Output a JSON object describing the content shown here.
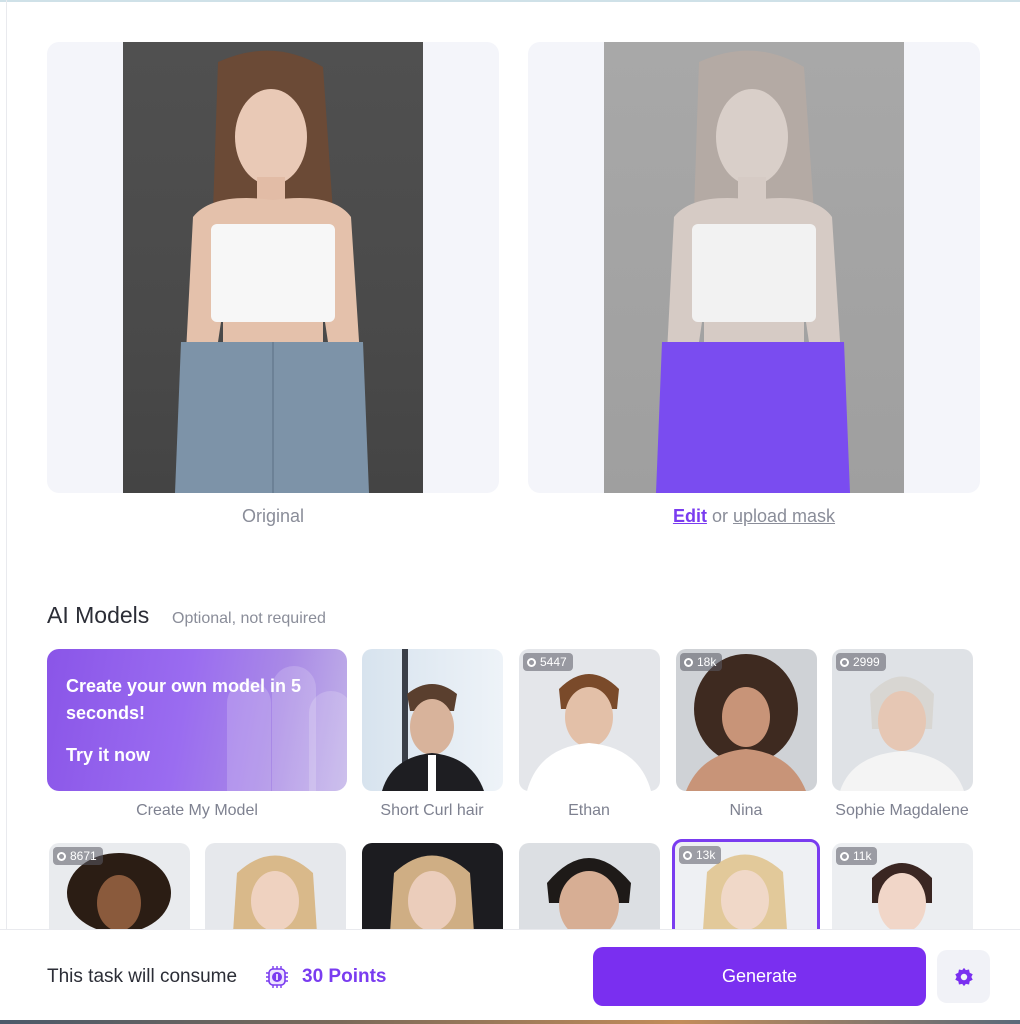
{
  "preview": {
    "original_caption": "Original",
    "edit_link": "Edit",
    "or_text": "or",
    "upload_mask_link": "upload mask",
    "mask_color": "#7a4cf0"
  },
  "models_section": {
    "title": "AI Models",
    "subtitle": "Optional, not required",
    "create_card": {
      "title": "Create your own model in 5 seconds!",
      "cta": "Try it now",
      "name": "Create My Model"
    },
    "row1": [
      {
        "name": "Short Curl hair",
        "count": ""
      },
      {
        "name": "Ethan",
        "count": "5447"
      },
      {
        "name": "Nina",
        "count": "18k"
      },
      {
        "name": "Sophie Magdalene",
        "count": "2999"
      }
    ],
    "row2": [
      {
        "count": "8671"
      },
      {
        "count": ""
      },
      {
        "count": ""
      },
      {
        "count": ""
      },
      {
        "count": "13k",
        "selected": true
      },
      {
        "count": "11k"
      }
    ]
  },
  "footer": {
    "consume_text": "This task will consume",
    "points": "30 Points",
    "generate_label": "Generate"
  },
  "colors": {
    "accent": "#7a2ff0",
    "panel_bg": "#f4f5fa"
  },
  "icons": {
    "points": "coin-chip-icon",
    "settings": "gear-icon",
    "badge": "star-circle-icon"
  }
}
